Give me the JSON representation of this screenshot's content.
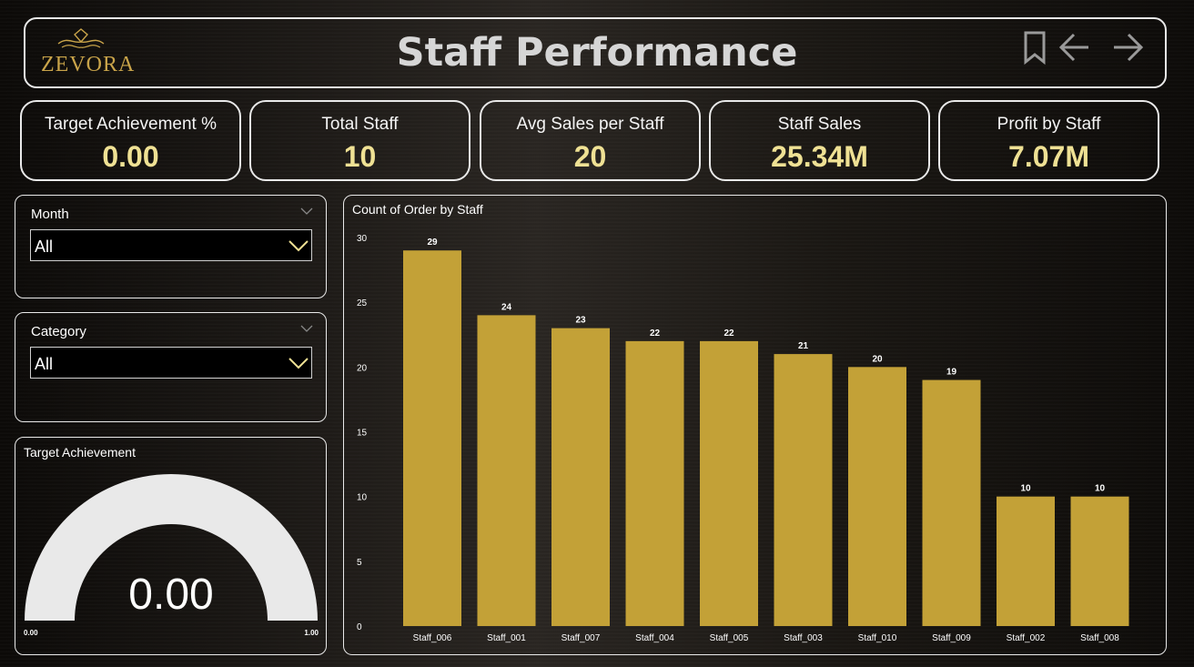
{
  "header": {
    "brand": "ZEVORA",
    "title": "Staff Performance",
    "icons": [
      "bookmark-icon",
      "back-arrow-icon",
      "forward-arrow-icon"
    ]
  },
  "kpis": [
    {
      "label": "Target Achievement %",
      "value": "0.00"
    },
    {
      "label": "Total Staff",
      "value": "10"
    },
    {
      "label": "Avg Sales per Staff",
      "value": "20"
    },
    {
      "label": "Staff Sales",
      "value": "25.34M"
    },
    {
      "label": "Profit by Staff",
      "value": "7.07M"
    }
  ],
  "filters": {
    "month": {
      "label": "Month",
      "value": "All"
    },
    "category": {
      "label": "Category",
      "value": "All"
    }
  },
  "gauge": {
    "title": "Target Achievement",
    "value": "0.00",
    "min": "0.00",
    "max": "1.00",
    "fill_fraction": 0
  },
  "colors": {
    "accent": "#c3a137",
    "kpi_value": "#efe194",
    "gauge_track": "#e9e9e9"
  },
  "chart_data": {
    "type": "bar",
    "title": "Count of Order by Staff",
    "xlabel": "",
    "ylabel": "",
    "categories": [
      "Staff_006",
      "Staff_001",
      "Staff_007",
      "Staff_004",
      "Staff_005",
      "Staff_003",
      "Staff_010",
      "Staff_009",
      "Staff_002",
      "Staff_008"
    ],
    "values": [
      29,
      24,
      23,
      22,
      22,
      21,
      20,
      19,
      10,
      10
    ],
    "ylim": [
      0,
      30
    ],
    "yticks": [
      0,
      5,
      10,
      15,
      20,
      25,
      30
    ],
    "data_labels": true,
    "grid": false,
    "bar_color": "#c3a137"
  }
}
